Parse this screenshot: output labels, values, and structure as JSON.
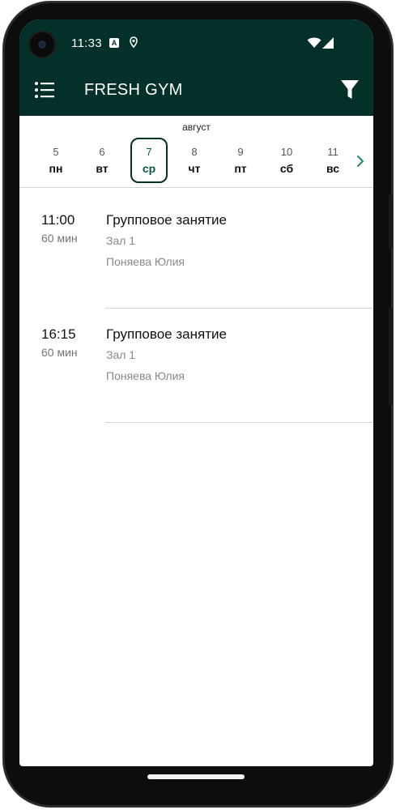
{
  "status_bar": {
    "time": "11:33",
    "icons": [
      "notification-a-icon",
      "location-icon",
      "wifi-icon",
      "signal-icon"
    ],
    "notification_letter": "A"
  },
  "app_bar": {
    "title": "FRESH GYM",
    "menu_icon": "menu-icon",
    "filter_icon": "filter-icon"
  },
  "calendar": {
    "month": "август",
    "days": [
      {
        "num": "5",
        "weekday": "пн",
        "selected": false
      },
      {
        "num": "6",
        "weekday": "вт",
        "selected": false
      },
      {
        "num": "7",
        "weekday": "ср",
        "selected": true
      },
      {
        "num": "8",
        "weekday": "чт",
        "selected": false
      },
      {
        "num": "9",
        "weekday": "пт",
        "selected": false
      },
      {
        "num": "10",
        "weekday": "сб",
        "selected": false
      },
      {
        "num": "11",
        "weekday": "вс",
        "selected": false
      }
    ],
    "next_icon": "chevron-right-icon"
  },
  "sessions": [
    {
      "time": "11:00",
      "duration": "60 мин",
      "title": "Групповое занятие",
      "room": "Зал 1",
      "coach": "Поняева Юлия"
    },
    {
      "time": "16:15",
      "duration": "60 мин",
      "title": "Групповое занятие",
      "room": "Зал 1",
      "coach": "Поняева Юлия"
    }
  ],
  "colors": {
    "primary": "#04302a",
    "accent": "#0b5a4a",
    "chevron": "#2f8c76",
    "divider": "#d4d4d4"
  }
}
